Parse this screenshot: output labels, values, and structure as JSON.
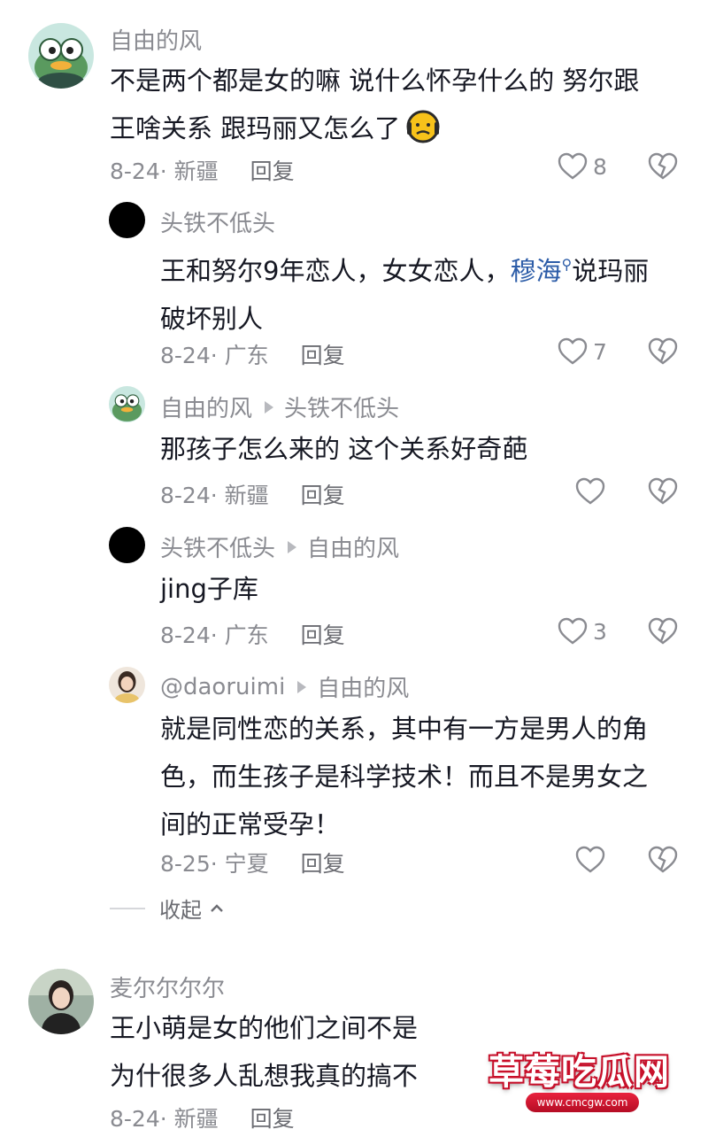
{
  "comments": [
    {
      "user": "自由的风",
      "text_lines": [
        "不是两个都是女的嘛 说什么怀孕什么的 努尔跟",
        "王啥关系 跟玛丽又怎么了"
      ],
      "emoji": "grimace-emoji",
      "date": "8-24",
      "location": "新疆",
      "reply": "回复",
      "likes": "8"
    }
  ],
  "replies": [
    {
      "user": "头铁不低头",
      "reply_to": "",
      "text_lines": [
        "王和努尔9年恋人，女女恋人，",
        "破坏别人"
      ],
      "link_text": "穆海",
      "after_link": "说玛丽",
      "date": "8-24",
      "location": "广东",
      "reply": "回复",
      "likes": "7"
    },
    {
      "user": "自由的风",
      "reply_to": "头铁不低头",
      "text_lines": [
        "那孩子怎么来的 这个关系好奇葩"
      ],
      "date": "8-24",
      "location": "新疆",
      "reply": "回复",
      "likes": ""
    },
    {
      "user": "头铁不低头",
      "reply_to": "自由的风",
      "text_lines": [
        "jing子库"
      ],
      "date": "8-24",
      "location": "广东",
      "reply": "回复",
      "likes": "3"
    },
    {
      "user": "@daoruimi",
      "reply_to": "自由的风",
      "text_lines": [
        "就是同性恋的关系，其中有一方是男人的角",
        "色，而生孩子是科学技术！而且不是男女之",
        "间的正常受孕！"
      ],
      "date": "8-25",
      "location": "宁夏",
      "reply": "回复",
      "likes": ""
    }
  ],
  "collapse_label": "收起",
  "last_comment": {
    "user": "麦尔尔尔尔",
    "text_lines": [
      "王小萌是女的他们之间不是",
      "为什很多人乱想我真的搞不"
    ],
    "date": "8-24",
    "location": "新疆",
    "reply": "回复"
  },
  "watermark": {
    "title": "草莓吃瓜网",
    "url": "www.cmcgw.com"
  },
  "colors": {
    "link": "#2d5da8",
    "muted": "#8a8b91",
    "text": "#161823",
    "watermark_red": "#c4102a"
  }
}
